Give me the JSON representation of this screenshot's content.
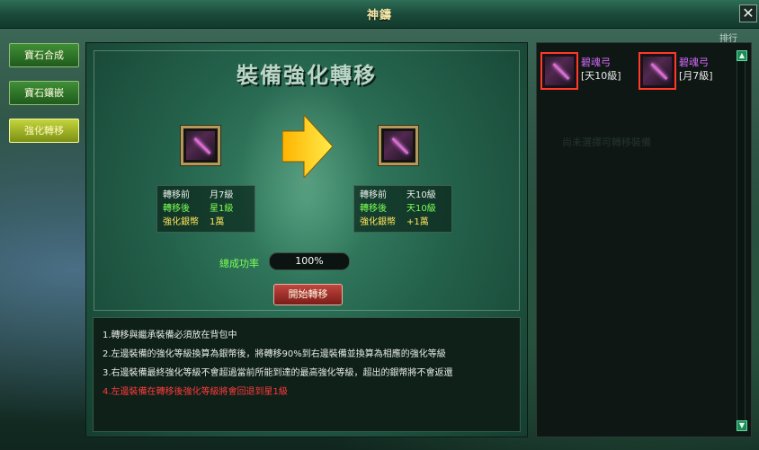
{
  "window": {
    "title": "神鑄",
    "close_label": "✕"
  },
  "left_tabs": [
    {
      "label": "寶石合成",
      "active": false
    },
    {
      "label": "寶石鑲嵌",
      "active": false
    },
    {
      "label": "強化轉移",
      "active": true
    }
  ],
  "corner_tag": "排行",
  "panel": {
    "heading": "裝備強化轉移",
    "left_info": {
      "rows": [
        {
          "key": "轉移前",
          "value": "月7級",
          "color": "white"
        },
        {
          "key": "轉移後",
          "value": "星1級",
          "color": "green"
        },
        {
          "key": "強化銀幣",
          "value": "1萬",
          "color": "yellow"
        }
      ]
    },
    "right_info": {
      "rows": [
        {
          "key": "轉移前",
          "value": "天10級",
          "color": "white"
        },
        {
          "key": "轉移後",
          "value": "天10級",
          "color": "green"
        },
        {
          "key": "強化銀幣",
          "value": "+1萬",
          "color": "yellow"
        }
      ]
    },
    "success_rate_label": "總成功率",
    "success_rate_value": "100%",
    "start_button": "開始轉移"
  },
  "notes": [
    "1.轉移與繼承裝備必須放在背包中",
    "2.左邊裝備的強化等級換算為銀幣後，將轉移90%到右邊裝備並換算為相應的強化等級",
    "3.右邊裝備最終強化等級不會超過當前所能到達的最高強化等級，超出的銀幣將不會返還",
    "4.左邊裝備在轉移後強化等級將會回退到星1級"
  ],
  "inventory": [
    {
      "name": "碧魂弓",
      "level": "[天10級]"
    },
    {
      "name": "碧魂弓",
      "level": "[月7級]"
    }
  ],
  "right_faded_note": "尚未選擇可轉移裝備",
  "scroll": {
    "up": "▲",
    "down": "▼"
  },
  "colors": {
    "accent_green": "#7cff55",
    "accent_yellow": "#ffe45a",
    "item_purple": "#d86bff",
    "warning_red": "#ff3a3a"
  }
}
